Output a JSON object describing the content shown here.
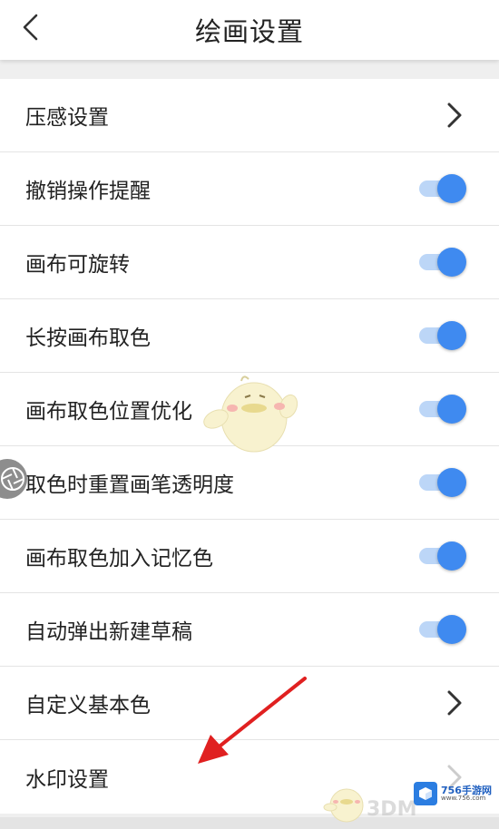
{
  "header": {
    "title": "绘画设置",
    "back_icon": "chevron-left-icon"
  },
  "settings": [
    {
      "label": "压感设置",
      "control": "chevron"
    },
    {
      "label": "撤销操作提醒",
      "control": "toggle",
      "on": true
    },
    {
      "label": "画布可旋转",
      "control": "toggle",
      "on": true
    },
    {
      "label": "长按画布取色",
      "control": "toggle",
      "on": true
    },
    {
      "label": "画布取色位置优化",
      "control": "toggle",
      "on": true
    },
    {
      "label": "取色时重置画笔透明度",
      "control": "toggle",
      "on": true
    },
    {
      "label": "画布取色加入记忆色",
      "control": "toggle",
      "on": true
    },
    {
      "label": "自动弹出新建草稿",
      "control": "toggle",
      "on": true
    },
    {
      "label": "自定义基本色",
      "control": "chevron"
    },
    {
      "label": "水印设置",
      "control": "chevron"
    }
  ],
  "colors": {
    "accent": "#3f8af0",
    "track": "#bcd6f7",
    "annotation_arrow": "#e02020"
  },
  "watermark": {
    "site_name": "756手游网",
    "site_url": "www.756.com",
    "brand": "3DM"
  }
}
